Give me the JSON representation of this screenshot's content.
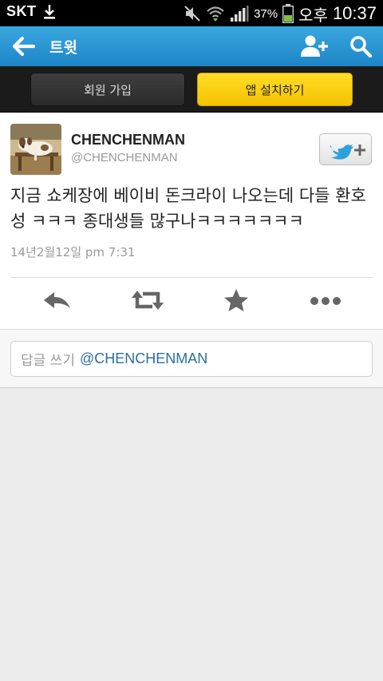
{
  "status_bar": {
    "carrier": "SKT",
    "battery_percent": "37%",
    "ampm": "오후",
    "time": "10:37",
    "icons": [
      "download-icon",
      "mute-icon",
      "wifi-icon",
      "signal-icon",
      "battery-icon"
    ]
  },
  "action_bar": {
    "title": "트윗",
    "icons": [
      "back-arrow-icon",
      "add-user-icon",
      "search-icon"
    ]
  },
  "signup_bar": {
    "signup_label": "회원 가입",
    "install_label": "앱 설치하기"
  },
  "tweet": {
    "display_name": "CHENCHENMAN",
    "screen_name": "@CHENCHENMAN",
    "text": "지금 쇼케장에 베이비 돈크라이 나오는데 다들 환호성 ㅋㅋㅋ 종대생들 많구나ㅋㅋㅋㅋㅋㅋㅋ",
    "timestamp": "14년2월12일 pm 7:31",
    "actions": [
      "reply-icon",
      "retweet-icon",
      "favorite-icon",
      "more-icon"
    ]
  },
  "reply": {
    "prefix": "답글 쓰기",
    "mention": "@CHENCHENMAN"
  },
  "colors": {
    "action_bar_blue": "#2594d3",
    "install_yellow": "#f8c900",
    "twitter_blue": "#2ea0dc",
    "mention_blue": "#2a6f9e"
  }
}
